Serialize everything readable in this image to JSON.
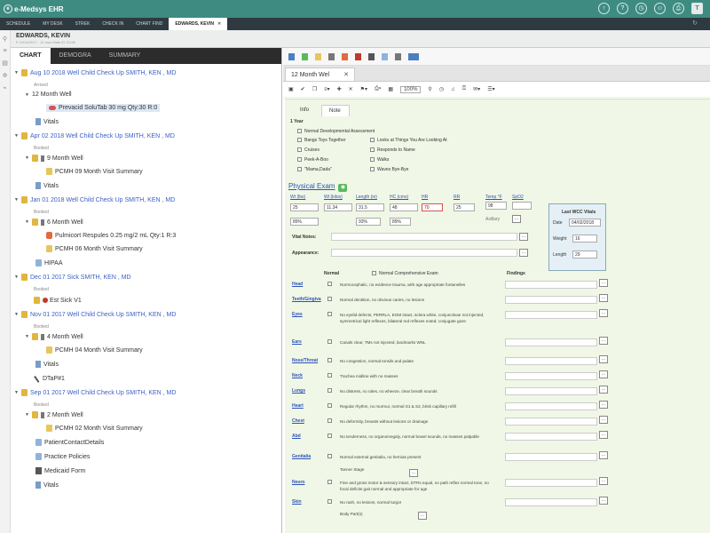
{
  "app": {
    "title": "e-Medsys EHR",
    "logo_letter": "e"
  },
  "top_icons": [
    "↑",
    "?",
    "◷",
    "☺",
    "⎙",
    "T"
  ],
  "tabs": [
    {
      "label": "SCHEDULE"
    },
    {
      "label": "MY DESK"
    },
    {
      "label": "STREK"
    },
    {
      "label": "CHECK IN"
    },
    {
      "label": "CHART FIND"
    },
    {
      "label": "EDWARDS, KEVIN",
      "active": true
    }
  ],
  "patient": {
    "name": "EDWARDS, KEVIN",
    "info": "F 10/14/2017 - 12 mos Male ID 11198"
  },
  "left_tabs": [
    "CHART",
    "DEMOGRA",
    "SUMMARY"
  ],
  "tree": [
    {
      "label": "Aug 10 2018 Well Child Check Up SMITH, KEN , MD",
      "status": "Arrived"
    },
    {
      "label": "12 Month Well"
    },
    {
      "label": "Prevacid SoluTab 30 mg Qty:30 R:0"
    },
    {
      "label": "Vitals"
    },
    {
      "label": "Apr 02 2018 Well Child Check Up SMITH, KEN , MD",
      "status": "Booked"
    },
    {
      "label": "9 Month Well"
    },
    {
      "label": "PCMH 09 Month Visit Summary"
    },
    {
      "label": "Vitals"
    },
    {
      "label": "Jan 01 2018 Well Child Check Up SMITH, KEN , MD",
      "status": "Booked"
    },
    {
      "label": "6 Month Well"
    },
    {
      "label": "Pulmicort Respules 0.25 mg/2 mL Qty:1 R:3"
    },
    {
      "label": "PCMH 06 Month Visit Summary"
    },
    {
      "label": "HIPAA"
    },
    {
      "label": "Dec 01 2017 Sick SMITH, KEN , MD",
      "status": "Booked"
    },
    {
      "label": "Est Sick V1"
    },
    {
      "label": "Nov 01 2017 Well Child Check Up SMITH, KEN , MD",
      "status": "Booked"
    },
    {
      "label": "4 Month Well"
    },
    {
      "label": "PCMH 04 Month Visit Summary"
    },
    {
      "label": "Vitals"
    },
    {
      "label": "DTaP#1"
    },
    {
      "label": "Sep 01 2017 Well Child Check Up SMITH, KEN , MD",
      "status": "Booked"
    },
    {
      "label": "2 Month Well"
    },
    {
      "label": "PCMH 02 Month Visit Summary"
    },
    {
      "label": "PatientContactDetails"
    },
    {
      "label": "Practice Policies"
    },
    {
      "label": "Medicaid Form"
    },
    {
      "label": "Vitals"
    }
  ],
  "doc_tab": "12 Month Wel",
  "zoom": "100%",
  "inner_tabs": [
    "Info",
    "Note"
  ],
  "form": {
    "age_heading": "1 Year",
    "dev_checks": [
      "Normal Developmental Assessment",
      "Bangs Toys Together",
      "Looks at Things You Are Looking At",
      "Cruises",
      "Responds to Name",
      "Peek-A-Boo",
      "Walks",
      "\"Mama,Dada\"",
      "Waves Bye-Bye"
    ],
    "physical_exam": "Physical Exam",
    "vital_labels": [
      "Wt (lbs)",
      "Wt (kilos)",
      "Length (in)",
      "HC (cms)",
      "HR",
      "RR",
      "Temp °F",
      "SpO2"
    ],
    "vital_values": [
      "25",
      "11.34",
      "31.5",
      "48",
      "70",
      "25",
      "98",
      ""
    ],
    "percentiles": [
      "89%",
      "93%",
      "89%"
    ],
    "temp_method": "Axillary",
    "vital_notes_label": "Vital Notes:",
    "appearance_label": "Appearance:",
    "last_wcc": {
      "title": "Last WCC Vitals",
      "date_label": "Date",
      "date": "04/02/2018",
      "weight_label": "Weight",
      "weight": "16",
      "length_label": "Length",
      "length": "29"
    },
    "normal_hdr": "Normal",
    "normal_exam": "Normal Comprehensive Exam",
    "findings_hdr": "Findings",
    "exam": [
      {
        "label": "Head",
        "text": "Normocephalic, no evidence trauma, with age appropriate fontanelles"
      },
      {
        "label": "Teeth/Gingiva",
        "text": "Normal dentition, no obvious caries, no lesions"
      },
      {
        "label": "Eyes",
        "text": "No eyelid defects, PERRLA, EOM intact, sclera white, conjunctivae not injected, symmetrical light reflexes, bilateral red reflexes noted; conjugate gaze"
      },
      {
        "label": "Ears",
        "text": "Canals clear, TMs not injected, landmarks WNL"
      },
      {
        "label": "Nose/Throat",
        "text": "No congestion, normal tonsils and palate"
      },
      {
        "label": "Neck",
        "text": "Trachea midline with no masses"
      },
      {
        "label": "Lungs",
        "text": "No distress, no rales, no wheeze, clear breath sounds"
      },
      {
        "label": "Heart",
        "text": "Regular rhythm, no murmur, normal S1 & S2, brisk capillary refill"
      },
      {
        "label": "Chest",
        "text": "No deformity, breasts without lesions or drainage"
      },
      {
        "label": "Abd",
        "text": "No tenderness, no organomegaly, normal bowel sounds, no masses palpable"
      },
      {
        "label": "Genitalia",
        "text": "Normal external genitalia, no hernias present",
        "extra": "Tanner Stage"
      },
      {
        "label": "Neuro",
        "text": "Fine and gross motor & sensory intact, DTRs equal, no path reflex normal tone, no focal deficits gait normal and appropriate for age"
      },
      {
        "label": "Skin",
        "text": "No rash, no lesions, normal turgor",
        "extra": "Body Part(s)"
      }
    ]
  }
}
